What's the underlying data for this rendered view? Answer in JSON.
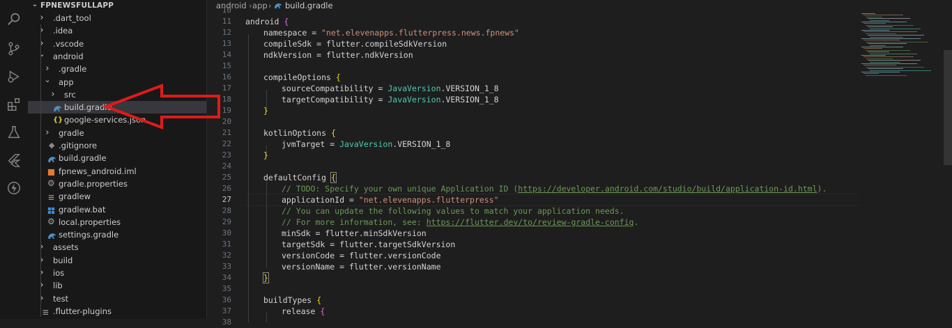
{
  "explorer": {
    "root": "FPNEWSFULLAPP",
    "items": [
      {
        "label": ".dart_tool",
        "type": "folder",
        "expanded": false
      },
      {
        "label": ".idea",
        "type": "folder",
        "expanded": false
      },
      {
        "label": ".vscode",
        "type": "folder",
        "expanded": false
      },
      {
        "label": "android",
        "type": "folder",
        "expanded": true
      },
      {
        "label": ".gradle",
        "type": "folder",
        "expanded": false
      },
      {
        "label": "app",
        "type": "folder",
        "expanded": true
      },
      {
        "label": "src",
        "type": "folder",
        "expanded": false
      },
      {
        "label": "build.gradle",
        "type": "gradle-file",
        "selected": true
      },
      {
        "label": "google-services.json",
        "type": "json-file"
      },
      {
        "label": "gradle",
        "type": "folder",
        "expanded": false
      },
      {
        "label": ".gitignore",
        "type": "gitignore-file"
      },
      {
        "label": "build.gradle",
        "type": "gradle-file"
      },
      {
        "label": "fpnews_android.iml",
        "type": "iml-file"
      },
      {
        "label": "gradle.properties",
        "type": "properties-file"
      },
      {
        "label": "gradlew",
        "type": "file"
      },
      {
        "label": "gradlew.bat",
        "type": "bat-file"
      },
      {
        "label": "local.properties",
        "type": "properties-file"
      },
      {
        "label": "settings.gradle",
        "type": "gradle-file"
      },
      {
        "label": "assets",
        "type": "folder",
        "expanded": false
      },
      {
        "label": "build",
        "type": "folder",
        "expanded": false
      },
      {
        "label": "ios",
        "type": "folder",
        "expanded": false
      },
      {
        "label": "lib",
        "type": "folder",
        "expanded": false
      },
      {
        "label": "test",
        "type": "folder",
        "expanded": false
      },
      {
        "label": ".flutter-plugins",
        "type": "file"
      }
    ]
  },
  "breadcrumb": {
    "part1": "android",
    "part2": "app",
    "part3": "build.gradle"
  },
  "editor": {
    "active_line": "27",
    "line_numbers": [
      "10",
      "11",
      "12",
      "13",
      "14",
      "15",
      "16",
      "17",
      "18",
      "19",
      "20",
      "21",
      "22",
      "23",
      "24",
      "25",
      "26",
      "27",
      "28",
      "29",
      "30",
      "31",
      "32",
      "33",
      "34",
      "35",
      "36",
      "37",
      "38"
    ],
    "code": {
      "l11_kw": "android",
      "l12_key": "namespace",
      "l12_val": "\"net.elevenapps.flutterpress.news.fpnews\"",
      "l13_key": "compileSdk",
      "l13_val": "flutter.compileSdkVersion",
      "l14_key": "ndkVersion",
      "l14_val": "flutter.ndkVersion",
      "l16_key": "compileOptions",
      "l17_key": "sourceCompatibility",
      "l17_type": "JavaVersion",
      "l17_val": ".VERSION_1_8",
      "l18_key": "targetCompatibility",
      "l18_type": "JavaVersion",
      "l18_val": ".VERSION_1_8",
      "l21_key": "kotlinOptions",
      "l22_key": "jvmTarget",
      "l22_type": "JavaVersion",
      "l22_val": ".VERSION_1_8",
      "l24_key": "defaultConfig",
      "l25_cmt": "// TODO: Specify your own unique Application ID (",
      "l25_link": "https://developer.android.com/studio/build/application-id.html",
      "l25_end": ").",
      "l26_key": "applicationId",
      "l26_val": "\"net.elevenapps.flutterpress\"",
      "l27_cmt": "// You can update the following values to match your application needs.",
      "l28_cmt": "// For more information, see: ",
      "l28_link": "https://flutter.dev/to/review-gradle-config",
      "l28_end": ".",
      "l29_key": "minSdk",
      "l29_val": "flutter.minSdkVersion",
      "l30_key": "targetSdk",
      "l30_val": "flutter.targetSdkVersion",
      "l31_key": "versionCode",
      "l31_val": "flutter.versionCode",
      "l32_key": "versionName",
      "l32_val": "flutter.versionName",
      "l35_key": "buildTypes",
      "l36_key": "release"
    }
  },
  "colors": {
    "annotation_arrow": "#e11a1a",
    "gradle_icon": "#4f8fbf",
    "json_icon": "#e8c84a"
  }
}
